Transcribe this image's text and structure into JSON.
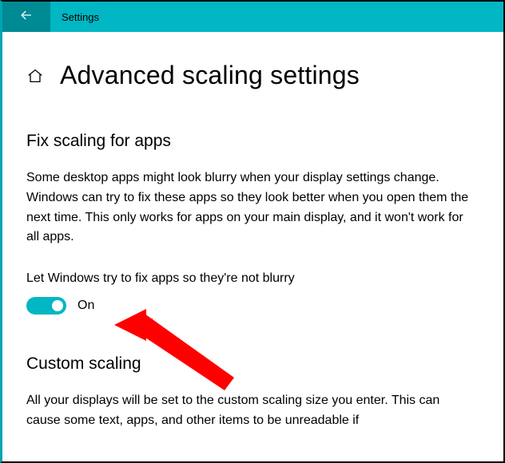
{
  "titlebar": {
    "title": "Settings"
  },
  "page": {
    "title": "Advanced scaling settings"
  },
  "section_fix": {
    "heading": "Fix scaling for apps",
    "body": "Some desktop apps might look blurry when your display settings change. Windows can try to fix these apps so they look better when you open them the next time. This only works for apps on your main display, and it won't work for all apps.",
    "toggle_label": "Let Windows try to fix apps so they're not blurry",
    "toggle_state": "On"
  },
  "section_custom": {
    "heading": "Custom scaling",
    "body": "All your displays will be set to the custom scaling size you enter. This can cause some text, apps, and other items to be unreadable if"
  },
  "colors": {
    "accent": "#00b7c3",
    "accent_dark": "#008a94",
    "annotation": "#ff0000"
  }
}
